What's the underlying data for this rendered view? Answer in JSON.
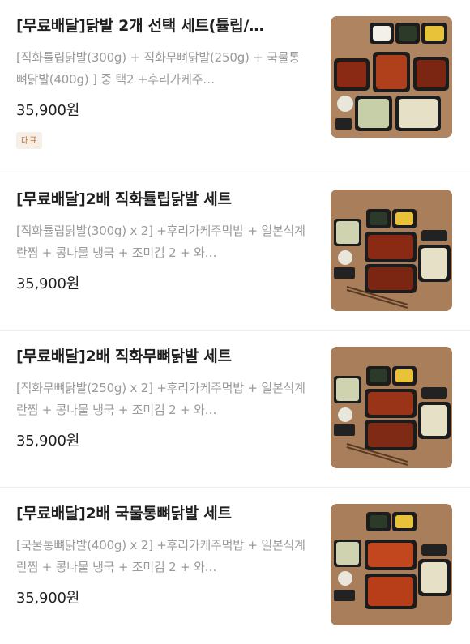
{
  "menu": {
    "items": [
      {
        "title": "[무료배달]닭발 2개 선택 세트(튤립/…",
        "description": "[직화튤립닭발(300g) + 직화무뼈닭발(250g) + 국물통뼈닭발(400g) ] 중 택2 +후리가케주…",
        "price": "35,900원",
        "badge": "대표",
        "image_icon": "food-photo-icon"
      },
      {
        "title": "[무료배달]2배 직화튤립닭발 세트",
        "description": "[직화튤립닭발(300g) x 2] +후리가케주먹밥 + 일본식계란찜 + 콩나물 냉국 + 조미김 2 + 와…",
        "price": "35,900원",
        "image_icon": "food-photo-icon"
      },
      {
        "title": "[무료배달]2배 직화무뼈닭발 세트",
        "description": "[직화무뼈닭발(250g) x 2] +후리가케주먹밥 + 일본식계란찜 + 콩나물 냉국 + 조미김 2 + 와…",
        "price": "35,900원",
        "image_icon": "food-photo-icon"
      },
      {
        "title": "[무료배달]2배 국물통뼈닭발 세트",
        "description": "[국물통뼈닭발(400g) x 2] +후리가케주먹밥 + 일본식계란찜 + 콩나물 냉국 + 조미김 2 + 와…",
        "price": "35,900원",
        "image_icon": "food-photo-icon"
      }
    ]
  },
  "colors": {
    "title": "#1f1f1f",
    "description": "#9a9a9a",
    "badge_bg": "#f6efe8",
    "badge_text": "#b57a45",
    "divider": "#ececec"
  }
}
